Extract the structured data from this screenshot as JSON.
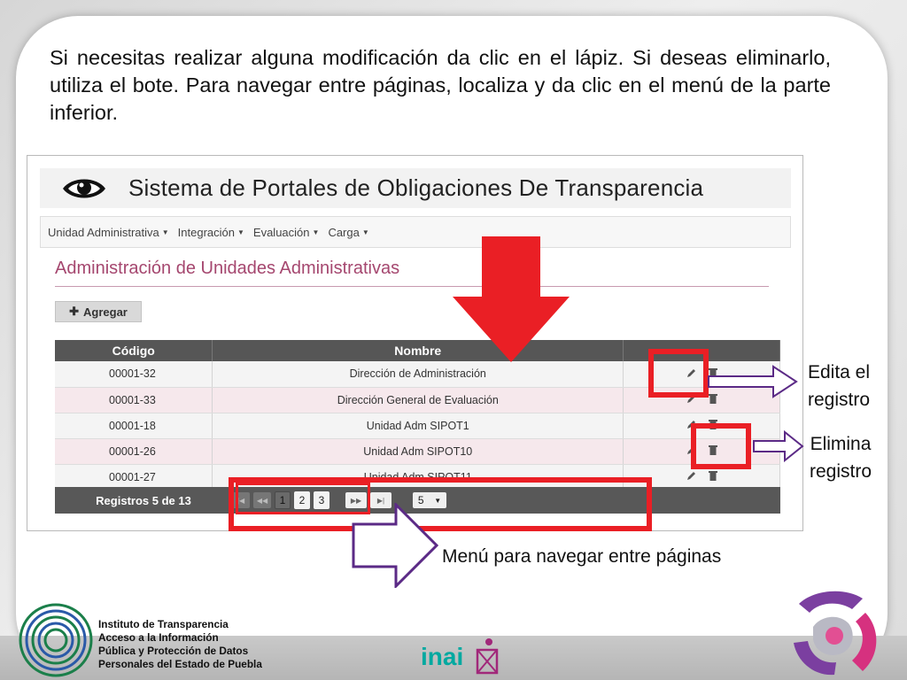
{
  "instruction_text": "Si necesitas realizar alguna modificación da clic en el lápiz. Si deseas eliminarlo, utiliza el bote. Para navegar entre páginas, localiza y da clic en el menú de la parte inferior.",
  "app": {
    "title": "Sistema de Portales de Obligaciones De Transparencia",
    "logo_icon": "eye-icon",
    "nav": [
      {
        "label": "Unidad Administrativa"
      },
      {
        "label": "Integración"
      },
      {
        "label": "Evaluación"
      },
      {
        "label": "Carga"
      }
    ],
    "page_heading": "Administración de Unidades Administrativas",
    "add_button": "Agregar",
    "table": {
      "headers": [
        "Código",
        "Nombre",
        ""
      ],
      "rows": [
        {
          "code": "00001-32",
          "name": "Dirección de Administración"
        },
        {
          "code": "00001-33",
          "name": "Dirección General de Evaluación"
        },
        {
          "code": "00001-18",
          "name": "Unidad Adm SIPOT1"
        },
        {
          "code": "00001-26",
          "name": "Unidad Adm SIPOT10"
        },
        {
          "code": "00001-27",
          "name": "Unidad Adm SIPOT11"
        }
      ],
      "row_action_icons": [
        "pencil-icon",
        "trash-icon"
      ]
    },
    "pager": {
      "records_label": "Registros 5 de 13",
      "pages": [
        "1",
        "2",
        "3"
      ],
      "current_page": "1",
      "page_size": "5"
    }
  },
  "annotations": {
    "edit_label_line1": "Edita el",
    "edit_label_line2": "registro",
    "delete_label_line1": "Elimina",
    "delete_label_line2": "registro",
    "nav_menu_caption": "Menú para navegar entre páginas"
  },
  "footer": {
    "institute_lines": [
      "Instituto de Transparencia",
      "Acceso a la Información",
      "Pública y Protección de Datos",
      "Personales del Estado de Puebla"
    ],
    "inai_logo_text": "inai"
  },
  "colors": {
    "accent_red": "#ea1f25",
    "arrow_purple": "#5b2a86",
    "heading_pink": "#a5476f",
    "table_header": "#565656",
    "inai_teal": "#00a9a0"
  }
}
